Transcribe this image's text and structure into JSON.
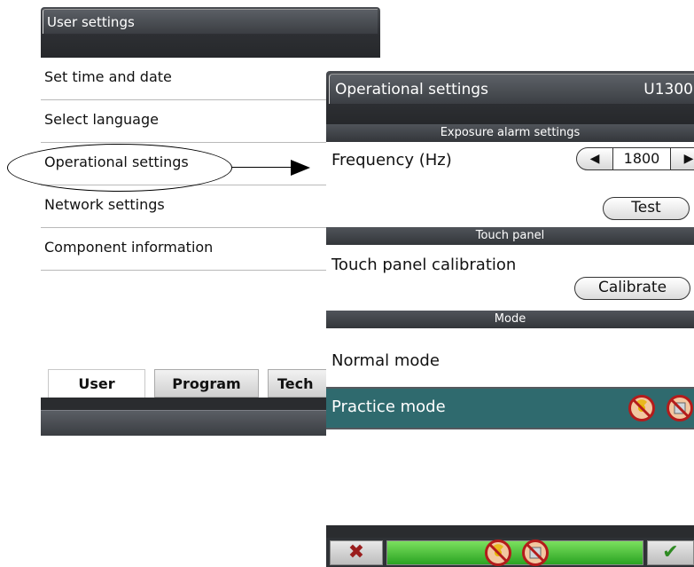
{
  "user_screen": {
    "title": "User settings",
    "menu": [
      {
        "label": "Set time and date"
      },
      {
        "label": "Select language"
      },
      {
        "label": "Operational settings"
      },
      {
        "label": "Network settings"
      },
      {
        "label": "Component information"
      }
    ],
    "tabs": [
      {
        "label": "User",
        "active": true
      },
      {
        "label": "Program",
        "active": false
      },
      {
        "label": "Tech",
        "active": false
      }
    ]
  },
  "op_screen": {
    "title": "Operational settings",
    "code": "U1300",
    "sections": {
      "exposure": "Exposure alarm settings",
      "touch": "Touch panel",
      "mode": "Mode"
    },
    "frequency": {
      "label": "Frequency (Hz)",
      "value": "1800",
      "left_icon": "triangle-left-icon",
      "right_icon": "triangle-right-icon"
    },
    "test_button": "Test",
    "touch_calibration": {
      "label": "Touch panel calibration",
      "button": "Calibrate"
    },
    "modes": {
      "normal": "Normal mode",
      "practice": "Practice mode"
    },
    "footer": {
      "cancel_icon": "cross-icon",
      "ok_icon": "check-icon"
    }
  },
  "colors": {
    "header_dark": "#2d2f33",
    "practice_row": "#2f6a6e",
    "progress_green": "#2aa322",
    "prohibit_red": "#b41b1b"
  }
}
